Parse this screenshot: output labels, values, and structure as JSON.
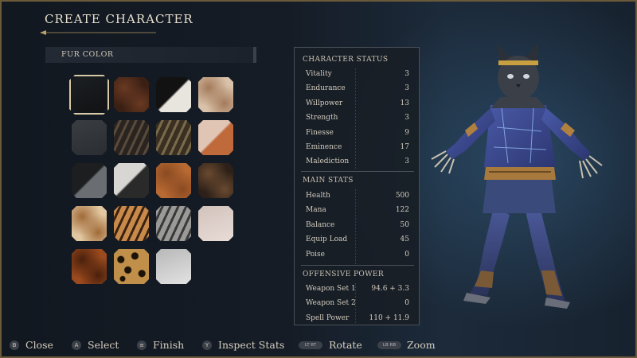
{
  "screen_title": "CREATE CHARACTER",
  "fur_section": {
    "label": "FUR COLOR",
    "selected_index": 0
  },
  "swatches": [
    {
      "name": "black",
      "c1": "#101214",
      "c2": "#1c1f22",
      "pattern": "solid"
    },
    {
      "name": "dark-brown",
      "c1": "#3a1f14",
      "c2": "#6a3a22",
      "pattern": "mottled"
    },
    {
      "name": "black-white",
      "c1": "#121212",
      "c2": "#e8e4de",
      "pattern": "split"
    },
    {
      "name": "cream",
      "c1": "#d9c2aa",
      "c2": "#a47a5a",
      "pattern": "mottled"
    },
    {
      "name": "charcoal",
      "c1": "#2a2d31",
      "c2": "#3a3d42",
      "pattern": "solid"
    },
    {
      "name": "dark-tabby",
      "c1": "#2a2420",
      "c2": "#5a4a3c",
      "pattern": "stripes"
    },
    {
      "name": "brown-tabby",
      "c1": "#3a3022",
      "c2": "#7a6a4c",
      "pattern": "stripes"
    },
    {
      "name": "calico",
      "c1": "#e0c4b4",
      "c2": "#c0693a",
      "pattern": "split"
    },
    {
      "name": "grey-black",
      "c1": "#1c1e20",
      "c2": "#6a6e72",
      "pattern": "split"
    },
    {
      "name": "white-black",
      "c1": "#d8d6d2",
      "c2": "#2a2a2a",
      "pattern": "split"
    },
    {
      "name": "orange",
      "c1": "#b86a32",
      "c2": "#8a4a22",
      "pattern": "mottled"
    },
    {
      "name": "dark-mottled",
      "c1": "#2c2018",
      "c2": "#6a4a30",
      "pattern": "mottled"
    },
    {
      "name": "pale-ginger",
      "c1": "#e2c8a2",
      "c2": "#a06a38",
      "pattern": "mottled"
    },
    {
      "name": "orange-tabby",
      "c1": "#c88a4a",
      "c2": "#3a2212",
      "pattern": "stripes"
    },
    {
      "name": "grey-tabby",
      "c1": "#9a9a98",
      "c2": "#3a3a3a",
      "pattern": "stripes"
    },
    {
      "name": "pale-pink",
      "c1": "#e8dcd6",
      "c2": "#d2c2bc",
      "pattern": "solid"
    },
    {
      "name": "rust",
      "c1": "#9a4a1e",
      "c2": "#4a200c",
      "pattern": "mottled"
    },
    {
      "name": "leopard",
      "c1": "#c0904a",
      "c2": "#1c1208",
      "pattern": "spots"
    },
    {
      "name": "white",
      "c1": "#e2e2e2",
      "c2": "#b8b8b8",
      "pattern": "solid"
    }
  ],
  "character_status": {
    "title": "CHARACTER STATUS",
    "rows": [
      {
        "label": "Vitality",
        "value": "3"
      },
      {
        "label": "Endurance",
        "value": "3"
      },
      {
        "label": "Willpower",
        "value": "13"
      },
      {
        "label": "Strength",
        "value": "3"
      },
      {
        "label": "Finesse",
        "value": "9"
      },
      {
        "label": "Eminence",
        "value": "17"
      },
      {
        "label": "Malediction",
        "value": "3"
      }
    ]
  },
  "main_stats": {
    "title": "MAIN STATS",
    "rows": [
      {
        "label": "Health",
        "value": "500"
      },
      {
        "label": "Mana",
        "value": "122"
      },
      {
        "label": "Balance",
        "value": "50"
      },
      {
        "label": "Equip Load",
        "value": "45"
      },
      {
        "label": "Poise",
        "value": "0"
      }
    ]
  },
  "offensive_power": {
    "title": "OFFENSIVE POWER",
    "rows": [
      {
        "label": "Weapon Set 1",
        "value": "94.6 + 3.3"
      },
      {
        "label": "Weapon Set 2",
        "value": "0"
      },
      {
        "label": "Spell Power",
        "value": "110 + 11.9"
      }
    ]
  },
  "footer": {
    "close": {
      "icon": "B",
      "label": "Close"
    },
    "select": {
      "icon": "A",
      "label": "Select"
    },
    "finish": {
      "icon": "≡",
      "label": "Finish"
    },
    "inspect": {
      "icon": "Y",
      "label": "Inspect Stats"
    },
    "rotate": {
      "icon": "LT RT",
      "label": "Rotate"
    },
    "zoom": {
      "icon": "LB RB",
      "label": "Zoom"
    }
  },
  "colors": {
    "accent": "#d8c9a4",
    "frame": "#6b5a3a",
    "panel_bg": "#181e26"
  }
}
